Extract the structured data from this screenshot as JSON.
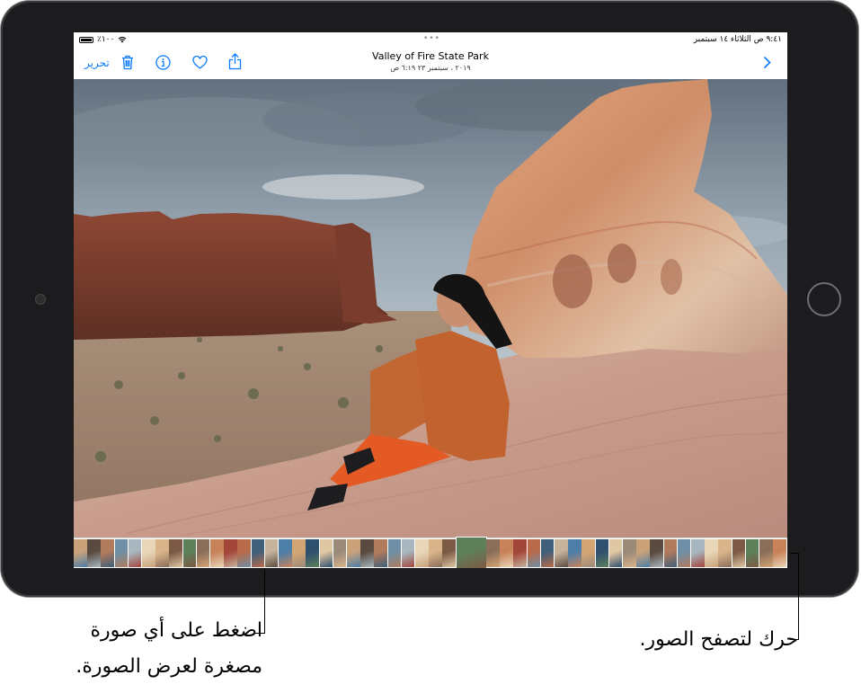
{
  "status_bar": {
    "time_date": "٩:٤١ ص الثلاثاء ١٤ سبتمبر",
    "battery": "٪١٠٠"
  },
  "multitask": "•••",
  "toolbar": {
    "edit_label": "تحرير",
    "delete_icon": "trash-icon",
    "info_icon": "info-icon",
    "favorite_icon": "heart-icon",
    "share_icon": "share-icon",
    "back_icon": "chevron-right-icon",
    "accent_color": "#0a7aff"
  },
  "photo": {
    "title": "Valley of Fire State Park",
    "subtitle": "٢٠١٩ ، سبتمبر ٢٣ ٦:١٩ ص"
  },
  "filmstrip": {
    "thumbnail_count": 52,
    "selected_index": 28
  },
  "callouts": {
    "tap_thumbnail_line1": "اضغط على أي صورة",
    "tap_thumbnail_line2": "مصغرة لعرض الصورة.",
    "drag_to_browse": "حرك لتصفح الصور."
  }
}
